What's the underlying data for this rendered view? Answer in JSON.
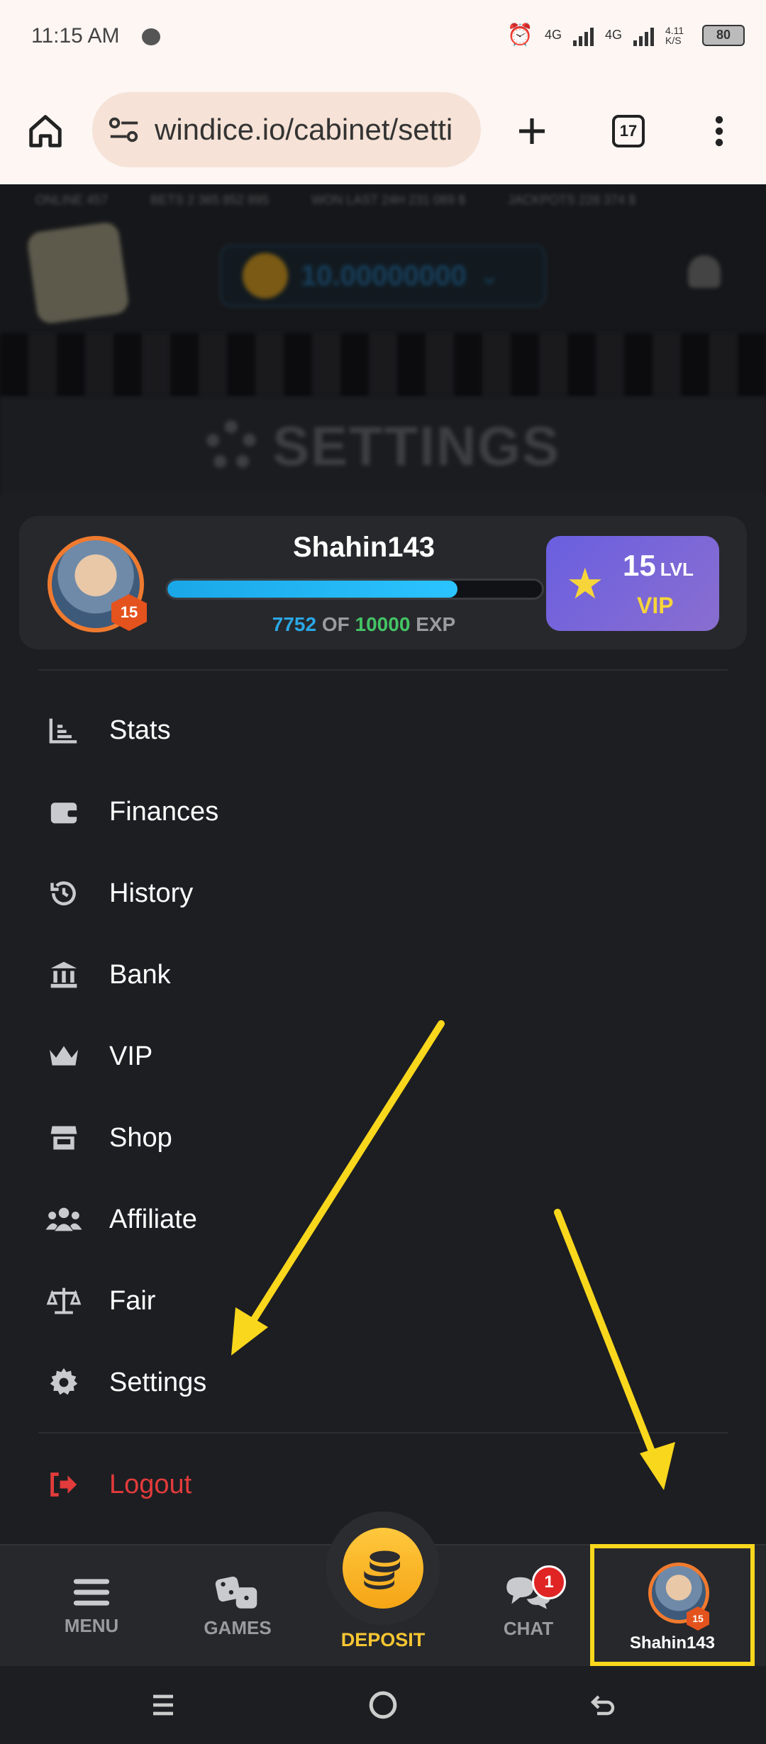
{
  "status_bar": {
    "time": "11:15 AM",
    "network_1": "4G",
    "network_2": "4G",
    "speed": "4.11 K/S",
    "battery": "80"
  },
  "browser": {
    "url": "windice.io/cabinet/setti",
    "tab_count": "17"
  },
  "blurred_header": {
    "ticker": [
      "ONLINE 457",
      "BETS 2 365 852 895",
      "WON LAST 24H 231 089 $",
      "JACKPOTS 228 374 $"
    ],
    "balance": "10.00000000",
    "banner_title": "SETTINGS"
  },
  "profile": {
    "username": "Shahin143",
    "level_badge": "15",
    "exp_current": "7752",
    "exp_of": "OF",
    "exp_max": "10000",
    "exp_unit": "EXP",
    "exp_progress": 0.7752,
    "vip_level": "15",
    "vip_lvl_label": "LVL",
    "vip_label": "VIP"
  },
  "menu": {
    "items": [
      {
        "label": "Stats",
        "icon": "bar-chart-icon"
      },
      {
        "label": "Finances",
        "icon": "wallet-icon"
      },
      {
        "label": "History",
        "icon": "history-icon"
      },
      {
        "label": "Bank",
        "icon": "bank-icon"
      },
      {
        "label": "VIP",
        "icon": "crown-icon"
      },
      {
        "label": "Shop",
        "icon": "store-icon"
      },
      {
        "label": "Affiliate",
        "icon": "users-icon"
      },
      {
        "label": "Fair",
        "icon": "scale-icon"
      },
      {
        "label": "Settings",
        "icon": "gear-icon"
      }
    ],
    "logout": "Logout"
  },
  "bottom_nav": {
    "menu": "MENU",
    "games": "GAMES",
    "deposit": "DEPOSIT",
    "chat": "CHAT",
    "chat_badge": "1",
    "profile_name": "Shahin143",
    "profile_level": "15"
  },
  "colors": {
    "accent_yellow": "#f9d71c",
    "exp_blue": "#2aa8e6",
    "exp_green": "#44c565",
    "logout_red": "#e23b3b",
    "vip_purple": "#6a5fe0"
  }
}
